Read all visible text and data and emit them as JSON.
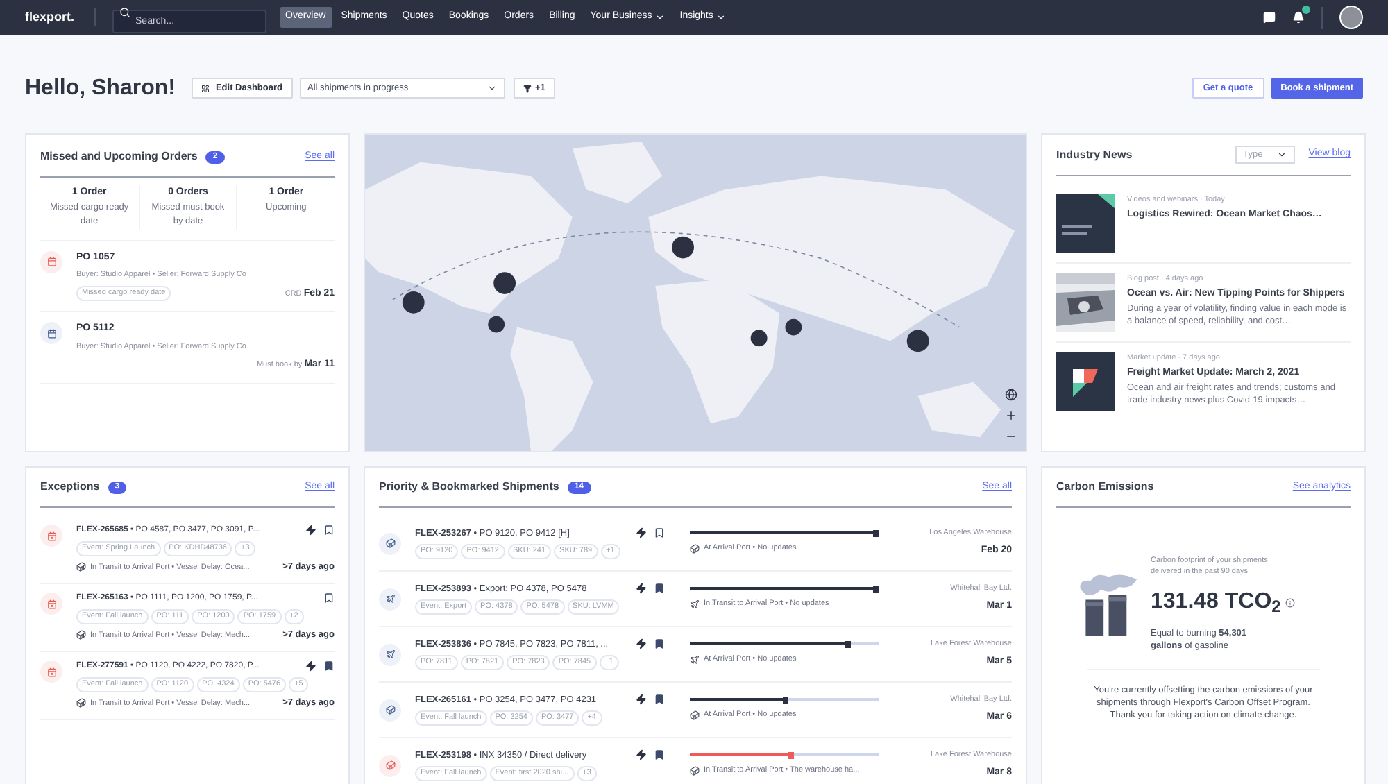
{
  "nav": {
    "logo": "flexport.",
    "search_placeholder": "Search...",
    "items": [
      {
        "label": "Overview",
        "selected": true,
        "dropdown": false
      },
      {
        "label": "Shipments",
        "selected": false,
        "dropdown": false
      },
      {
        "label": "Quotes",
        "selected": false,
        "dropdown": false
      },
      {
        "label": "Bookings",
        "selected": false,
        "dropdown": false
      },
      {
        "label": "Orders",
        "selected": false,
        "dropdown": false
      },
      {
        "label": "Billing",
        "selected": false,
        "dropdown": false
      },
      {
        "label": "Your Business",
        "selected": false,
        "dropdown": true
      },
      {
        "label": "Insights",
        "selected": false,
        "dropdown": true
      }
    ],
    "notifications": true
  },
  "header": {
    "greeting": "Hello, Sharon!",
    "edit_button": "Edit Dashboard",
    "filter_select": "All shipments in progress",
    "filter_button": "+1",
    "quote_button": "Get a quote",
    "book_button": "Book a shipment"
  },
  "orders": {
    "title": "Missed and Upcoming Orders",
    "count": "2",
    "link": "See all",
    "summary": [
      {
        "count": "1 Order",
        "label": "Missed cargo ready date"
      },
      {
        "count": "0 Orders",
        "label": "Missed must book by date"
      },
      {
        "count": "1 Order",
        "label": "Upcoming"
      }
    ],
    "items": [
      {
        "po": "PO 1057",
        "parties": "Buyer: Studio Apparel • Seller: Forward Supply Co",
        "tag": "Missed cargo ready date",
        "date_label": "CRD",
        "date": "Feb 21",
        "missed": true
      },
      {
        "po": "PO 5112",
        "parties": "Buyer: Studio Apparel • Seller: Forward Supply Co",
        "date_label": "Must book by",
        "date": "Mar 11",
        "missed": false
      }
    ]
  },
  "news": {
    "title": "Industry News",
    "type_select": "Type",
    "link": "View blog",
    "items": [
      {
        "meta": "Videos and webinars · Today",
        "title": "Logistics Rewired: Ocean Market Chaos…",
        "kind": "video"
      },
      {
        "meta": "Blog post · 4 days ago",
        "title": "Ocean vs. Air: New Tipping Points for Shippers",
        "description": "During a year of volatility, finding value in each mode is a balance of speed, reliability, and cost…"
      },
      {
        "meta": "Market update · 7 days ago",
        "title": "Freight Market Update: March 2, 2021",
        "description": "Ocean and air freight rates and trends; customs and trade industry news plus Covid-19 impacts…",
        "kind": "logo"
      }
    ]
  },
  "exceptions": {
    "title": "Exceptions",
    "count": "3",
    "link": "See all",
    "items": [
      {
        "title": "**FLEX-265685** • PO 4587, PO 3477, PO 3091, P...",
        "tags": [
          "Event: Spring Launch",
          "PO: KDHD48736",
          "+3"
        ],
        "kind": "ocean",
        "status": "In Transit to Arrival Port • Vessel Delay: Ocea...",
        "age": ">7 days ago",
        "priority": true,
        "bookmarked": false
      },
      {
        "title": "**FLEX-265163** • PO 1111, PO 1200, PO 1759, P...",
        "tags": [
          "Event: Fall launch",
          "PO: 111",
          "PO: 1200",
          "PO: 1759",
          "+2"
        ],
        "kind": "ocean",
        "status": "In Transit to Arrival Port • Vessel Delay: Mech...",
        "age": ">7 days ago",
        "priority": false,
        "bookmarked": false
      },
      {
        "title": "**FLEX-277591** • PO 1120, PO 4222, PO 7820, P...",
        "tags": [
          "Event: Fall launch",
          "PO: 1120",
          "PO: 4324",
          "PO: 5476",
          "+5"
        ],
        "kind": "ocean",
        "status": "In Transit to Arrival Port • Vessel Delay: Mech...",
        "age": ">7 days ago",
        "priority": true,
        "bookmarked": true
      }
    ]
  },
  "shipments": {
    "title": "Priority & Bookmarked Shipments",
    "count": "14",
    "link": "See all",
    "items": [
      {
        "title": "**FLEX-253267** • PO 9120, PO 9412 [H]",
        "tags": [
          "PO: 9120",
          "PO: 9412",
          "SKU: 241",
          "SKU: 789",
          "+1"
        ],
        "kind": "ocean",
        "exception": false,
        "priority": true,
        "bookmarked": false,
        "level": 1,
        "status": "At Arrival Port • No updates",
        "destination": "Los Angeles Warehouse",
        "date": "Feb 20"
      },
      {
        "title": "**FLEX-253893** • Export: PO 4378, PO 5478",
        "tags": [
          "Event: Export",
          "PO: 4378",
          "PO: 5478",
          "SKU: LVMM"
        ],
        "kind": "air",
        "exception": false,
        "priority": true,
        "bookmarked": true,
        "level": 1,
        "status": "In Transit to Arrival Port • No updates",
        "destination": "Whitehall Bay Ltd.",
        "date": "Mar 1"
      },
      {
        "title": "**FLEX-253836** • PO 7845, PO 7823, PO 7811, ...",
        "tags": [
          "PO: 7811",
          "PO: 7821",
          "PO: 7823",
          "PO: 7845",
          "+1"
        ],
        "kind": "air",
        "exception": false,
        "priority": true,
        "bookmarked": true,
        "level": 0.85,
        "status": "At Arrival Port • No updates",
        "destination": "Lake Forest Warehouse",
        "date": "Mar 5"
      },
      {
        "title": "**FLEX-265161** • PO 3254, PO 3477, PO 4231",
        "tags": [
          "Event: Fall launch",
          "PO: 3254",
          "PO: 3477",
          "+4"
        ],
        "kind": "ocean",
        "exception": false,
        "priority": true,
        "bookmarked": true,
        "level": 0.52,
        "status": "At Arrival Port • No updates",
        "destination": "Whitehall Bay Ltd.",
        "date": "Mar 6"
      },
      {
        "title": "**FLEX-253198** • INX 34350 / Direct delivery",
        "tags": [
          "Event: Fall launch",
          "Event: first 2020 shi...",
          "+3"
        ],
        "kind": "ocean",
        "exception": true,
        "priority": true,
        "bookmarked": true,
        "level": 0.55,
        "status": "In Transit to Arrival Port • The warehouse ha...",
        "destination": "Lake Forest Warehouse",
        "date": "Mar 8"
      }
    ]
  },
  "carbon": {
    "title": "Carbon Emissions",
    "link": "See analytics",
    "caption": "Carbon footprint of your shipments delivered in the past 90 days",
    "value": "131.48 TCO$_{2}$",
    "equivalent": "Equal to burning **54,301 gallons** of gasoline",
    "note": "You're currently offsetting the carbon emissions of your shipments through Flexport's Carbon Offset Program. Thank you for taking action on climate change."
  }
}
